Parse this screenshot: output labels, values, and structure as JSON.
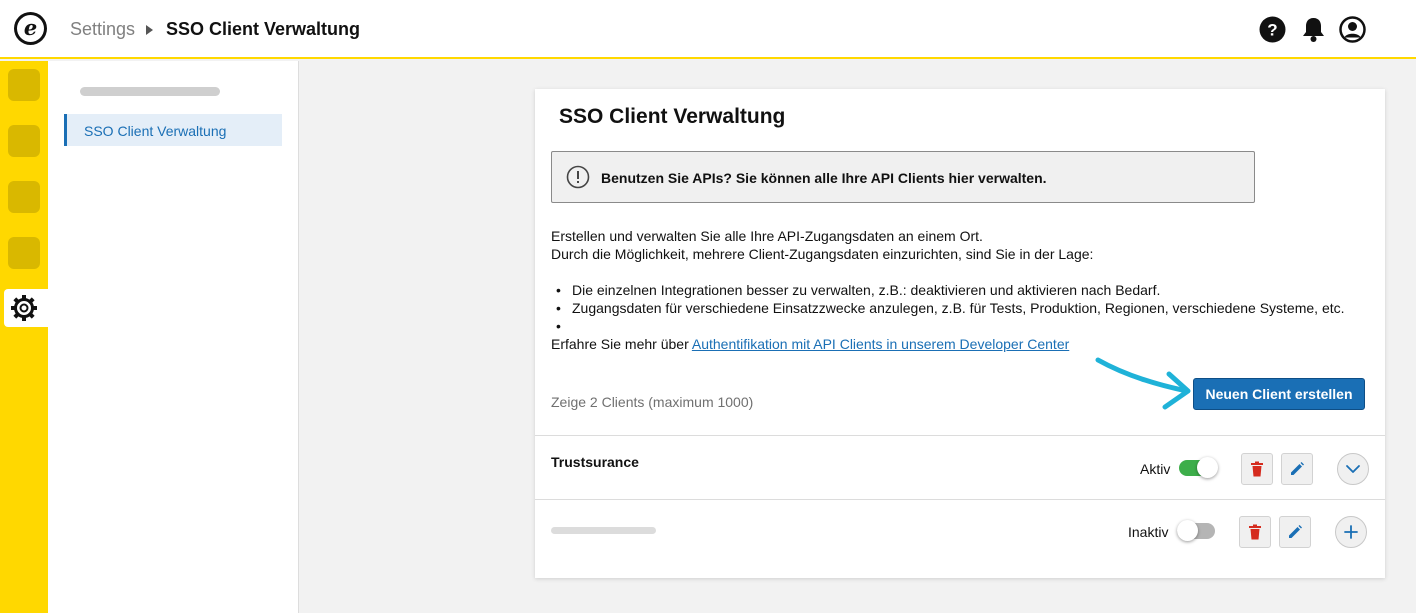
{
  "header": {
    "logo_letter": "e",
    "breadcrumb_parent": "Settings",
    "breadcrumb_current": "SSO Client Verwaltung",
    "icons": [
      "help-icon",
      "bell-icon",
      "user-icon"
    ]
  },
  "rail": {
    "active_icon": "gear-icon"
  },
  "sidebar": {
    "items": [
      {
        "label": "SSO Client Verwaltung",
        "active": true
      }
    ]
  },
  "card": {
    "title": "SSO Client Verwaltung",
    "info_text": "Benutzen Sie APIs? Sie können alle Ihre API Clients hier verwalten.",
    "description": [
      "Erstellen und verwalten Sie alle Ihre API-Zugangsdaten an einem Ort.",
      "Durch die Möglichkeit, mehrere Client-Zugangsdaten einzurichten, sind Sie in der Lage:"
    ],
    "bullets": [
      "Die einzelnen Integrationen besser zu verwalten, z.B.: deaktivieren und aktivieren nach Bedarf.",
      "Zugangsdaten für verschiedene Einsatzzwecke anzulegen, z.B. für Tests, Produktion, Regionen, verschiedene Systeme, etc.",
      ""
    ],
    "learn_more_prefix": "Erfahre Sie mehr über ",
    "learn_more_link": "Authentifikation mit API Clients in unserem Developer Center",
    "clients_count": "Zeige 2 Clients (maximum 1000)",
    "new_client_button": "Neuen Client erstellen"
  },
  "clients": [
    {
      "name": "Trustsurance",
      "status": "Aktiv",
      "active": true,
      "expand_icon": "chevron-down-icon"
    },
    {
      "name": "",
      "status": "Inaktiv",
      "active": false,
      "expand_icon": "plus-icon"
    }
  ],
  "colors": {
    "accent_yellow": "#ffd800",
    "primary_blue": "#1a6fb5",
    "toggle_on": "#3dae4a",
    "delete_red": "#d52b1e",
    "annotation_arrow": "#1fb2d8"
  }
}
